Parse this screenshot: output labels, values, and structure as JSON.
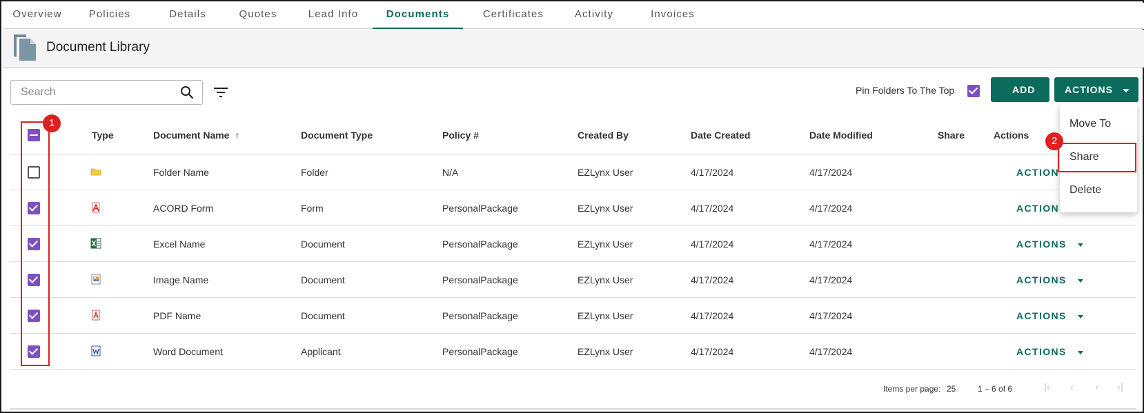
{
  "tabs": [
    {
      "label": "Overview",
      "active": false
    },
    {
      "label": "Policies",
      "active": false
    },
    {
      "label": "Details",
      "active": false
    },
    {
      "label": "Quotes",
      "active": false
    },
    {
      "label": "Lead Info",
      "active": false
    },
    {
      "label": "Documents",
      "active": true
    },
    {
      "label": "Certificates",
      "active": false
    },
    {
      "label": "Activity",
      "active": false
    },
    {
      "label": "Invoices",
      "active": false
    }
  ],
  "header": {
    "title": "Document Library"
  },
  "toolbar": {
    "search_placeholder": "Search",
    "pin_label": "Pin Folders To The Top",
    "pin_checked": true,
    "add_label": "ADD",
    "actions_label": "ACTIONS"
  },
  "table": {
    "columns": [
      "Type",
      "Document Name",
      "Document Type",
      "Policy #",
      "Created By",
      "Date Created",
      "Date Modified",
      "Share",
      "Actions"
    ],
    "sort_column": "Document Name",
    "sort_direction": "ascending",
    "rows": [
      {
        "file_icon": "folder-icon",
        "name": "Folder Name",
        "doc_type": "Folder",
        "policy": "N/A",
        "created_by": "EZLynx User",
        "date_created": "4/17/2024",
        "date_modified": "4/17/2024",
        "actions_label": "ACTIONS",
        "checked": false
      },
      {
        "file_icon": "acord-form-icon",
        "name": "ACORD Form",
        "doc_type": "Form",
        "policy": "PersonalPackage",
        "created_by": "EZLynx User",
        "date_created": "4/17/2024",
        "date_modified": "4/17/2024",
        "actions_label": "ACTIONS",
        "checked": true
      },
      {
        "file_icon": "excel-icon",
        "name": "Excel Name",
        "doc_type": "Document",
        "policy": "PersonalPackage",
        "created_by": "EZLynx User",
        "date_created": "4/17/2024",
        "date_modified": "4/17/2024",
        "actions_label": "ACTIONS",
        "checked": true
      },
      {
        "file_icon": "image-file-icon",
        "name": "Image Name",
        "doc_type": "Document",
        "policy": "PersonalPackage",
        "created_by": "EZLynx User",
        "date_created": "4/17/2024",
        "date_modified": "4/17/2024",
        "actions_label": "ACTIONS",
        "checked": true
      },
      {
        "file_icon": "pdf-icon",
        "name": "PDF Name",
        "doc_type": "Document",
        "policy": "PersonalPackage",
        "created_by": "EZLynx User",
        "date_created": "4/17/2024",
        "date_modified": "4/17/2024",
        "actions_label": "ACTIONS",
        "checked": true
      },
      {
        "file_icon": "word-icon",
        "name": "Word Document",
        "doc_type": "Applicant",
        "policy": "PersonalPackage",
        "created_by": "EZLynx User",
        "date_created": "4/17/2024",
        "date_modified": "4/17/2024",
        "actions_label": "ACTIONS",
        "checked": true
      }
    ]
  },
  "footer": {
    "items_per_page_label": "Items per page:",
    "items_per_page": "25",
    "range": "1 – 6 of 6"
  },
  "actions_menu": {
    "items": [
      "Move To",
      "Share",
      "Delete"
    ],
    "highlighted": "Share"
  },
  "annotations": {
    "marker_1": "1",
    "marker_2": "2"
  },
  "colors": {
    "accent": "#0b6b5d",
    "checkbox": "#7e4fc3",
    "annotation": "#e02020"
  }
}
